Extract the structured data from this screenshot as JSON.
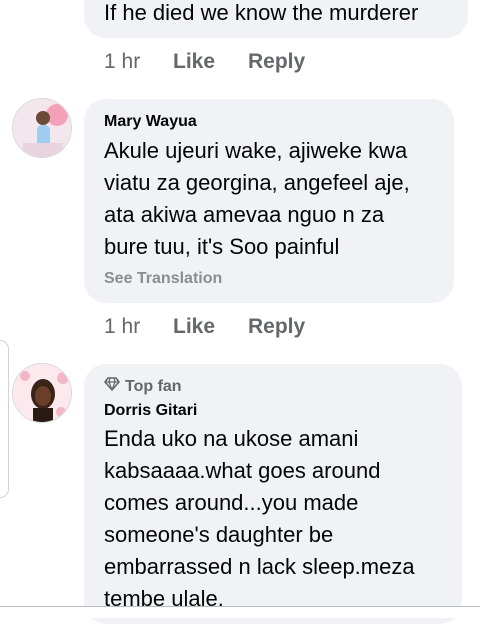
{
  "comments": [
    {
      "body": "If he died we know the murderer",
      "time": "1 hr",
      "like_label": "Like",
      "reply_label": "Reply"
    },
    {
      "name": "Mary Wayua",
      "body_lines": [
        "Akule ujeuri wake, ajiweke kwa",
        "viatu za georgina, angefeel aje,",
        "ata akiwa amevaa nguo n za",
        "bure tuu, it's Soo painful"
      ],
      "see_translation": "See Translation",
      "time": "1 hr",
      "like_label": "Like",
      "reply_label": "Reply"
    },
    {
      "badge": "Top fan",
      "name": "Dorris Gitari",
      "body_lines": [
        "Enda uko na ukose amani",
        "kabsaaaa.what goes around",
        "comes around...you made",
        "someone's daughter be",
        "embarrassed n lack sleep.meza",
        "tembe ulale."
      ]
    }
  ],
  "icons": {
    "badge_icon": "diamond-icon"
  },
  "colors": {
    "bubble": "#f0f2f5",
    "secondary_text": "#65676b",
    "translation_text": "#8a8d91"
  }
}
